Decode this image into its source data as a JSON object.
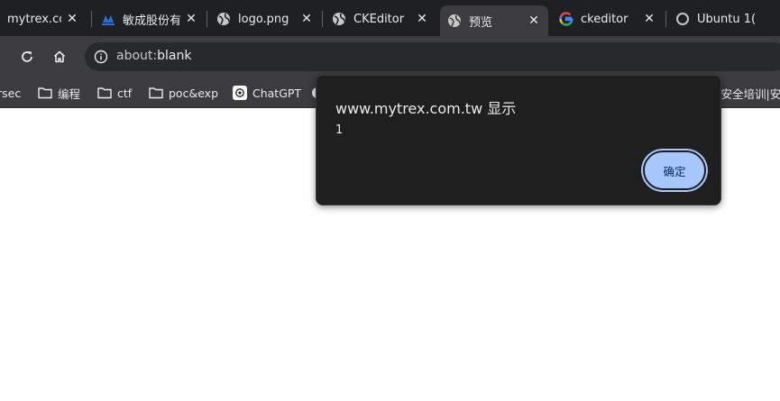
{
  "tabs": [
    {
      "title": "mytrex.co",
      "favicon": "mytrex-icon",
      "close_label": "✕"
    },
    {
      "title": "敏成股份有",
      "favicon": "mytrex-logo-icon",
      "close_label": "✕"
    },
    {
      "title": "logo.png",
      "favicon": "globe-icon",
      "close_label": "✕"
    },
    {
      "title": "CKEditor",
      "favicon": "globe-icon",
      "close_label": "✕"
    },
    {
      "title": "预览",
      "favicon": "globe-icon",
      "close_label": "✕",
      "active": true
    },
    {
      "title": "ckeditor",
      "favicon": "google-icon",
      "close_label": "✕"
    },
    {
      "title": "Ubuntu 1(",
      "favicon": "loading-icon"
    }
  ],
  "toolbar": {
    "address": "about:blank",
    "address_scheme": "about:",
    "address_rest": "blank"
  },
  "bookmarks": [
    {
      "label": "rsec",
      "icon": "none"
    },
    {
      "label": "编程",
      "icon": "folder-icon"
    },
    {
      "label": "ctf",
      "icon": "folder-icon"
    },
    {
      "label": "poc&exp",
      "icon": "folder-icon"
    },
    {
      "label": "ChatGPT",
      "icon": "chatgpt-icon"
    },
    {
      "label": "",
      "icon": "circle-icon"
    },
    {
      "label": "-安全培训|安",
      "icon": "none"
    }
  ],
  "dialog": {
    "title": "www.mytrex.com.tw 显示",
    "message": "1",
    "ok_label": "确定"
  },
  "colors": {
    "tab_bar_bg": "#1f2023",
    "toolbar_bg": "#3c3c3e",
    "dialog_bg": "#1f1f1f",
    "ok_button_bg": "#a8c7fa",
    "text_light": "#e8eaed"
  }
}
